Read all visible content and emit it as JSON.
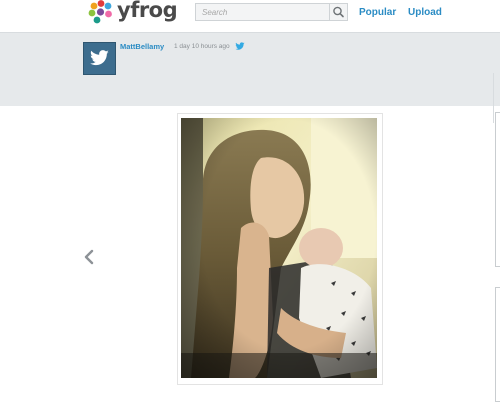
{
  "header": {
    "logo_text": "yfrog",
    "search": {
      "placeholder": "Search",
      "value": ""
    },
    "nav": {
      "popular": "Popular",
      "upload": "Upload"
    }
  },
  "post": {
    "username": "MattBellamy",
    "timestamp": "1 day 10 hours ago",
    "photo": {
      "alt_icon": "photo-image"
    }
  },
  "icons": {
    "logo": "yfrog-logo-icon",
    "search": "search-icon",
    "avatar": "twitter-bird-icon",
    "source": "twitter-bird-icon",
    "prev": "chevron-left-icon"
  },
  "colors": {
    "brand_link": "#2b8cc4",
    "band": "#e6e9eb",
    "avatar_bg": "#3d6d8e",
    "logo_text": "#4a4a4a"
  }
}
